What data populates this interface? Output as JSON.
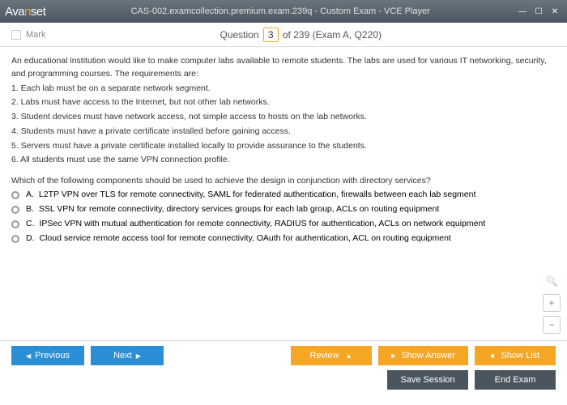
{
  "titlebar": {
    "logo_pre": "Ava",
    "logo_n": "n",
    "logo_post": "set",
    "title": "CAS-002.examcollection.premium.exam.239q - Custom Exam - VCE Player"
  },
  "header": {
    "mark_label": "Mark",
    "q_pre": "Question",
    "q_num": "3",
    "q_post": " of 239 (Exam A, Q220)"
  },
  "question": {
    "intro": "An educational institution would like to make computer labs available to remote students. The labs are used for various IT networking, security, and programming courses. The requirements are:",
    "req1": "1. Each lab must be on a separate network segment.",
    "req2": "2. Labs must have access to the Internet, but not other lab networks.",
    "req3": "3. Student devices must have network access, not simple access to hosts on the lab networks.",
    "req4": "4. Students must have a private certificate installed before gaining access.",
    "req5": "5. Servers must have a private certificate installed locally to provide assurance to the students.",
    "req6": "6. All students must use the same VPN connection profile.",
    "prompt": "Which of the following components should be used to achieve the design in conjunction with directory services?"
  },
  "options": {
    "a": {
      "letter": "A.",
      "text": "L2TP VPN over TLS for remote connectivity, SAML for federated authentication, firewalls between each lab segment"
    },
    "b": {
      "letter": "B.",
      "text": "SSL VPN for remote connectivity, directory services groups for each lab group, ACLs on routing equipment"
    },
    "c": {
      "letter": "C.",
      "text": "IPSec VPN with mutual authentication for remote connectivity, RADIUS for authentication, ACLs on network equipment"
    },
    "d": {
      "letter": "D.",
      "text": "Cloud service remote access tool for remote connectivity, OAuth for authentication, ACL on routing equipment"
    }
  },
  "footer": {
    "previous": "Previous",
    "next": "Next",
    "review": "Review",
    "show_answer": "Show Answer",
    "show_list": "Show List",
    "save_session": "Save Session",
    "end_exam": "End Exam"
  }
}
